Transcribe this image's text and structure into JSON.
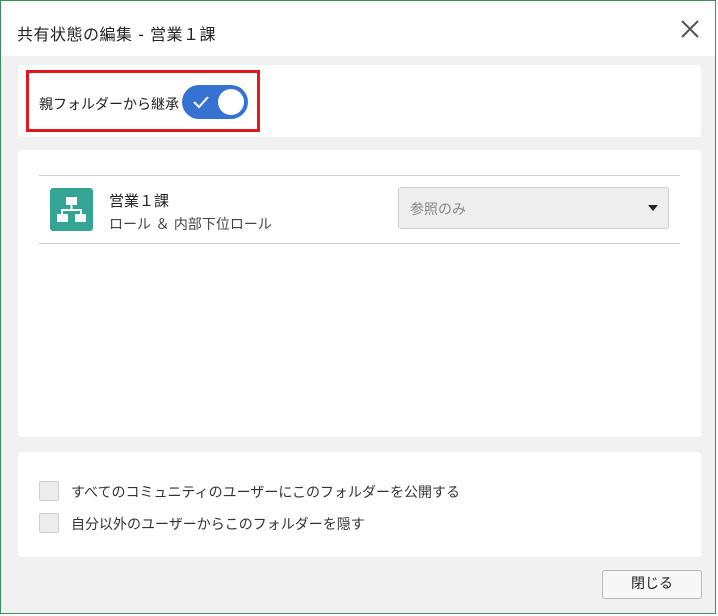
{
  "dialog": {
    "title": "共有状態の編集 - 営業１課",
    "close_icon": "close-icon"
  },
  "inherit": {
    "label": "親フォルダーから継承",
    "toggle_on": true,
    "toggle_icon": "check-icon",
    "accent_color": "#3572d2",
    "highlight_color": "#e3171e"
  },
  "share_list": {
    "items": [
      {
        "icon": "org-chart-icon",
        "icon_color": "#35a593",
        "name": "営業１課",
        "type": "ロール ＆ 内部下位ロール",
        "permission": "参照のみ"
      }
    ]
  },
  "options": {
    "publish_to_community": {
      "label": "すべてのコミュニティのユーザーにこのフォルダーを公開する",
      "checked": false
    },
    "hide_from_others": {
      "label": "自分以外のユーザーからこのフォルダーを隠す",
      "checked": false
    }
  },
  "footer": {
    "close_button": "閉じる"
  }
}
